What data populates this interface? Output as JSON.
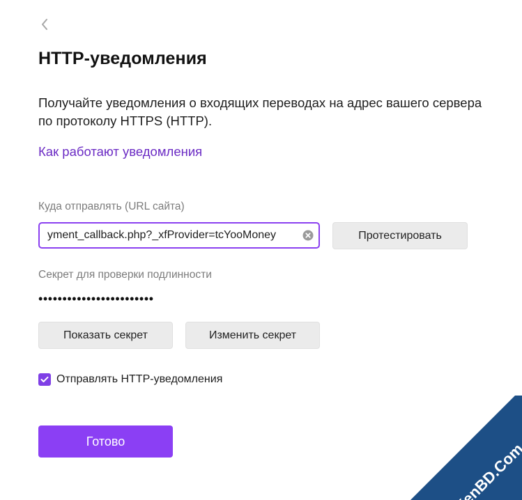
{
  "header": {
    "back_icon": "chevron-left-icon",
    "title": "HTTP-уведомления"
  },
  "intro": {
    "description": "Получайте уведомления о входящих переводах на адрес вашего сервера по протоколу HTTPS (HTTP).",
    "help_link": "Как работают уведомления"
  },
  "url_field": {
    "label": "Куда отправлять (URL сайта)",
    "value": "yment_callback.php?_xfProvider=tcYooMoney",
    "clear_icon": "clear-circle-icon",
    "test_button": "Протестировать"
  },
  "secret": {
    "label": "Секрет для проверки подлинности",
    "masked_value": "••••••••••••••••••••••••",
    "show_button": "Показать секрет",
    "change_button": "Изменить секрет"
  },
  "notifications": {
    "checkbox_label": "Отправлять HTTP-уведомления",
    "checked": true
  },
  "actions": {
    "done_button": "Готово"
  },
  "watermark": {
    "text": "XenBD.Com"
  },
  "colors": {
    "accent": "#8b3ff4",
    "link": "#6b2bc4",
    "input_border": "#8a3ff0",
    "button_gray": "#ebebeb",
    "watermark_bg": "#1d4f86"
  }
}
